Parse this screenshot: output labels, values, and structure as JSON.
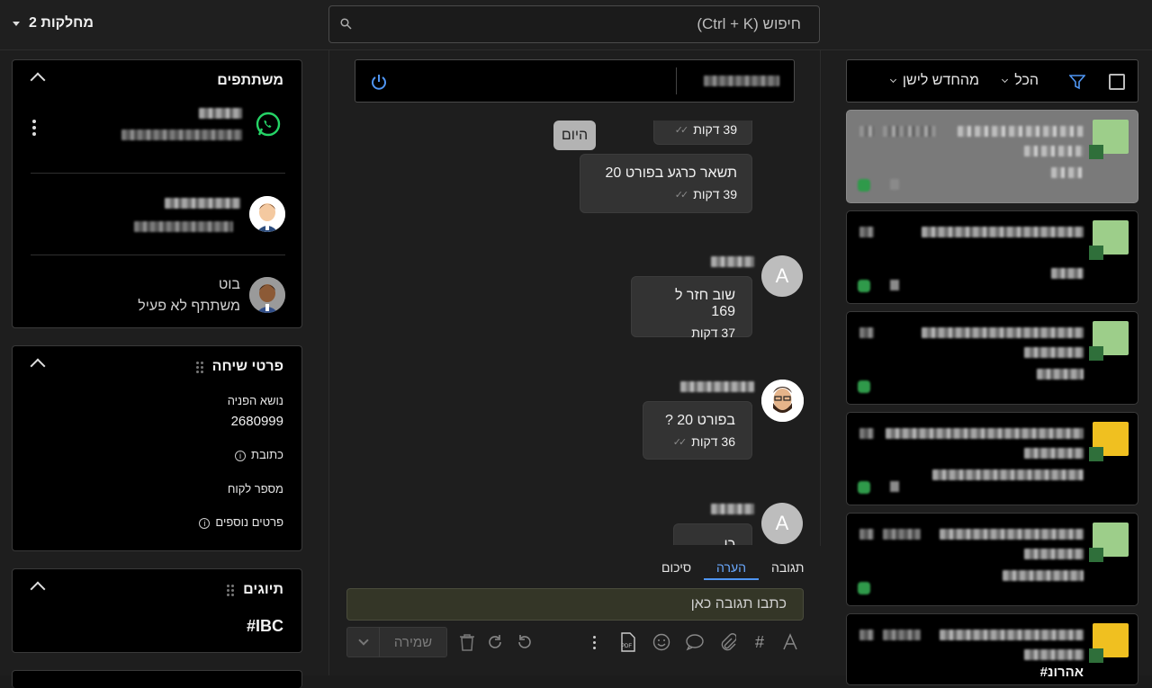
{
  "topbar": {
    "departments_label": "2 מחלקות",
    "search_placeholder": "חיפוש (Ctrl + K)"
  },
  "participants": {
    "title": "משתתפים",
    "bot_name": "בוט",
    "bot_status": "משתתף לא פעיל"
  },
  "conversation_details": {
    "title": "פרטי שיחה",
    "subject_label": "נושא הפניה",
    "subject_value": "2680999",
    "address_label": "כתובת",
    "customer_number_label": "מספר לקוח",
    "more_details_label": "פרטים נוספים"
  },
  "tags": {
    "title": "תיוגים",
    "tag_1": "IBC#"
  },
  "chat": {
    "partial_time": "39 דקות",
    "today_label": "היום",
    "messages": [
      {
        "text": "תשאר כרגע בפורט 20",
        "time": "39 דקות"
      },
      {
        "text": "שוב חזר ל 169",
        "time": "37 דקות"
      },
      {
        "text": "בפורט 20 ?",
        "time": "36 דקות"
      },
      {
        "text": "כן",
        "time": ""
      }
    ],
    "avatar_letter_1": "A",
    "avatar_letter_2": "A"
  },
  "composer": {
    "tabs": [
      "תגובה",
      "הערה",
      "סיכום"
    ],
    "active_tab": "הערה",
    "placeholder": "כתבו תגובה כאן",
    "save_label": "שמירה"
  },
  "conversation_list": {
    "filter_all": "הכל",
    "sort_label": "מהחדש לישן",
    "last_card_tag": "#אהרונ"
  },
  "colors": {
    "accent_blue": "#4f95f2",
    "whatsapp_green": "#25d366",
    "reply_bg": "#343627",
    "selected_card": "#7a7a7a"
  }
}
